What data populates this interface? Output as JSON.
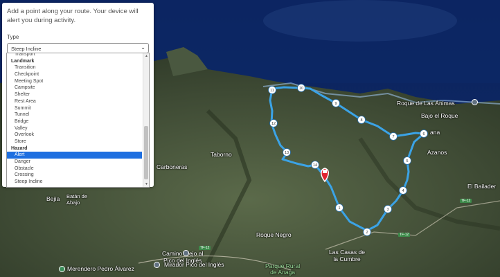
{
  "panel": {
    "intro_text": "Add a point along your route. Your device will alert you during activity.",
    "type_label": "Type",
    "selected_type": "Steep Incline"
  },
  "type_options": [
    {
      "label": "Transport",
      "group": false
    },
    {
      "label": "Landmark",
      "group": true
    },
    {
      "label": "Transition",
      "group": false
    },
    {
      "label": "Checkpoint",
      "group": false
    },
    {
      "label": "Meeting Spot",
      "group": false
    },
    {
      "label": "Campsite",
      "group": false
    },
    {
      "label": "Shelter",
      "group": false
    },
    {
      "label": "Rest Area",
      "group": false
    },
    {
      "label": "Summit",
      "group": false
    },
    {
      "label": "Tunnel",
      "group": false
    },
    {
      "label": "Bridge",
      "group": false
    },
    {
      "label": "Valley",
      "group": false
    },
    {
      "label": "Overlook",
      "group": false
    },
    {
      "label": "Store",
      "group": false
    },
    {
      "label": "Hazard",
      "group": true
    },
    {
      "label": "Alert",
      "group": false,
      "selected": true
    },
    {
      "label": "Danger",
      "group": false
    },
    {
      "label": "Obstacle",
      "group": false
    },
    {
      "label": "Crossing",
      "group": false
    },
    {
      "label": "Steep Incline",
      "group": false
    }
  ],
  "map_labels": {
    "roque_animas": "Roque de Las Ánimas",
    "bajo_roque": "Bajo el Roque",
    "chana": "ana",
    "azanos": "Azanos",
    "taborno": "Taborno",
    "carbonera": "Carboneras",
    "bailader": "El Bailader",
    "bejia": "Bejía",
    "batan": "Batán de\nAbajo",
    "roque_negro": "Roque Negro",
    "las_casas": "Las Casas de\nla Cumbre",
    "camino_viejo": "Camino Viejo al\nPico del Inglés",
    "mirador": "Mirador Pico del Inglés",
    "merendero": "Merendero Pedro Álvarez",
    "parque": "Parque Rural\nde Anaga",
    "shield_tf12": "TF-12",
    "shield_tf12b": "TF-12",
    "shield_tf12c": "TF-12"
  },
  "route_waypoints": [
    "1",
    "2",
    "3",
    "4",
    "5",
    "6",
    "7",
    "8",
    "9",
    "10",
    "11",
    "12",
    "13",
    "14"
  ],
  "colors": {
    "route": "#3ba3e6",
    "marker": "#e02330",
    "selection": "#1e6fe0"
  }
}
